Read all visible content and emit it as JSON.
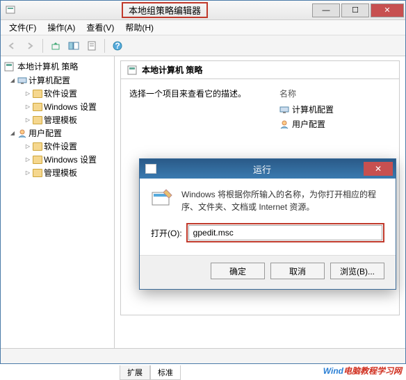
{
  "window": {
    "title": "本地组策略编辑器"
  },
  "menu": {
    "file": "文件(F)",
    "action": "操作(A)",
    "view": "查看(V)",
    "help": "帮助(H)"
  },
  "tree": {
    "root": "本地计算机 策略",
    "computer_config": "计算机配置",
    "user_config": "用户配置",
    "software_settings": "软件设置",
    "windows_settings": "Windows 设置",
    "admin_templates": "管理模板"
  },
  "content": {
    "header": "本地计算机 策略",
    "description": "选择一个项目来查看它的描述。",
    "name_col": "名称",
    "items": {
      "computer_config": "计算机配置",
      "user_config": "用户配置"
    }
  },
  "tabs": {
    "extended": "扩展",
    "standard": "标准"
  },
  "run_dialog": {
    "title": "运行",
    "description": "Windows 将根据你所输入的名称，为你打开相应的程序、文件夹、文档或 Internet 资源。",
    "open_label": "打开(O):",
    "input_value": "gpedit.msc",
    "ok": "确定",
    "cancel": "取消",
    "browse": "浏览(B)..."
  },
  "watermark": {
    "part1": "Wind",
    "part2": "电脑教程学习网"
  }
}
